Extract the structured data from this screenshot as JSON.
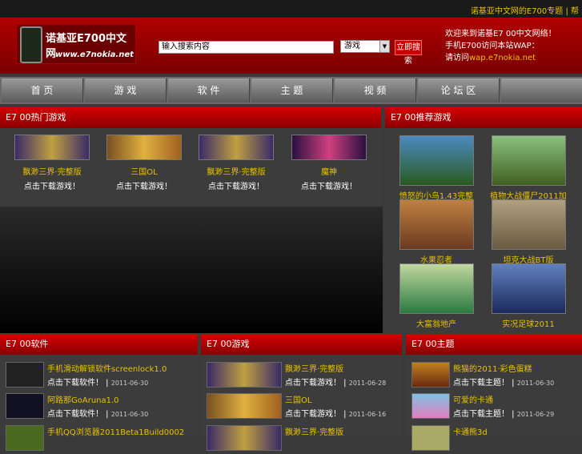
{
  "topbar": {
    "links": "诺基亚中文网的E700专题 | 帮"
  },
  "logo": {
    "title": "诺基亚E700中文网",
    "url": "www.e7nokia.net"
  },
  "search": {
    "value": "输入搜索内容",
    "select": "游戏",
    "button": "立即搜索"
  },
  "header_info": {
    "line1": "欢迎来到诺基E7 00中文网络！",
    "line2": "手机E700访问本站WAP：",
    "line3_prefix": "请访问",
    "line3_link": "wap.e7nokia.net"
  },
  "nav": [
    "首 页",
    "游 戏",
    "软 件",
    "主 题",
    "视 频",
    "论 坛 区"
  ],
  "hot_games": {
    "heading": "E7 00热门游戏",
    "items": [
      {
        "title": "飘渺三界·完整版",
        "desc": "点击下载游戏！"
      },
      {
        "title": "三国OL",
        "desc": "点击下载游戏！"
      },
      {
        "title": "飘渺三界·完整版",
        "desc": "点击下载游戏！"
      },
      {
        "title": "魔神",
        "desc": "点击下载游戏！"
      }
    ]
  },
  "recommended": {
    "heading": "E7 00推荐游戏",
    "items": [
      "愤怒的小鸟1.43完整版",
      "植物大战僵尸2011加强版",
      "水果忍者",
      "坦克大战BT版",
      "大富翁地产",
      "实况足球2011"
    ]
  },
  "software": {
    "heading": "E7 00软件",
    "items": [
      {
        "title": "手机滑动解锁软件screenlock1.0",
        "meta": "点击下载软件！",
        "date": "2011-06-30"
      },
      {
        "title": "阿路那GoAruna1.0",
        "meta": "点击下载软件！",
        "date": "2011-06-30"
      },
      {
        "title": "手机QQ浏览器2011Beta1Build0002",
        "meta": "",
        "date": ""
      }
    ]
  },
  "games": {
    "heading": "E7 00游戏",
    "items": [
      {
        "title": "飘渺三界·完整版",
        "meta": "点击下载游戏！",
        "date": "2011-06-28"
      },
      {
        "title": "三国OL",
        "meta": "点击下载游戏！",
        "date": "2011-06-16"
      },
      {
        "title": "飘渺三界·完整版",
        "meta": "",
        "date": ""
      }
    ]
  },
  "themes": {
    "heading": "E7 00主题",
    "items": [
      {
        "title": "熊猫的2011·彩色蛋糕",
        "meta": "点击下载主题！",
        "date": "2011-06-30"
      },
      {
        "title": "可爱的卡通",
        "meta": "点击下载主题！",
        "date": "2011-06-29"
      },
      {
        "title": "卡通熊3d",
        "meta": "",
        "date": ""
      }
    ]
  },
  "colors": {
    "brand_red": "#c00000",
    "accent_yellow": "#e8c200"
  }
}
